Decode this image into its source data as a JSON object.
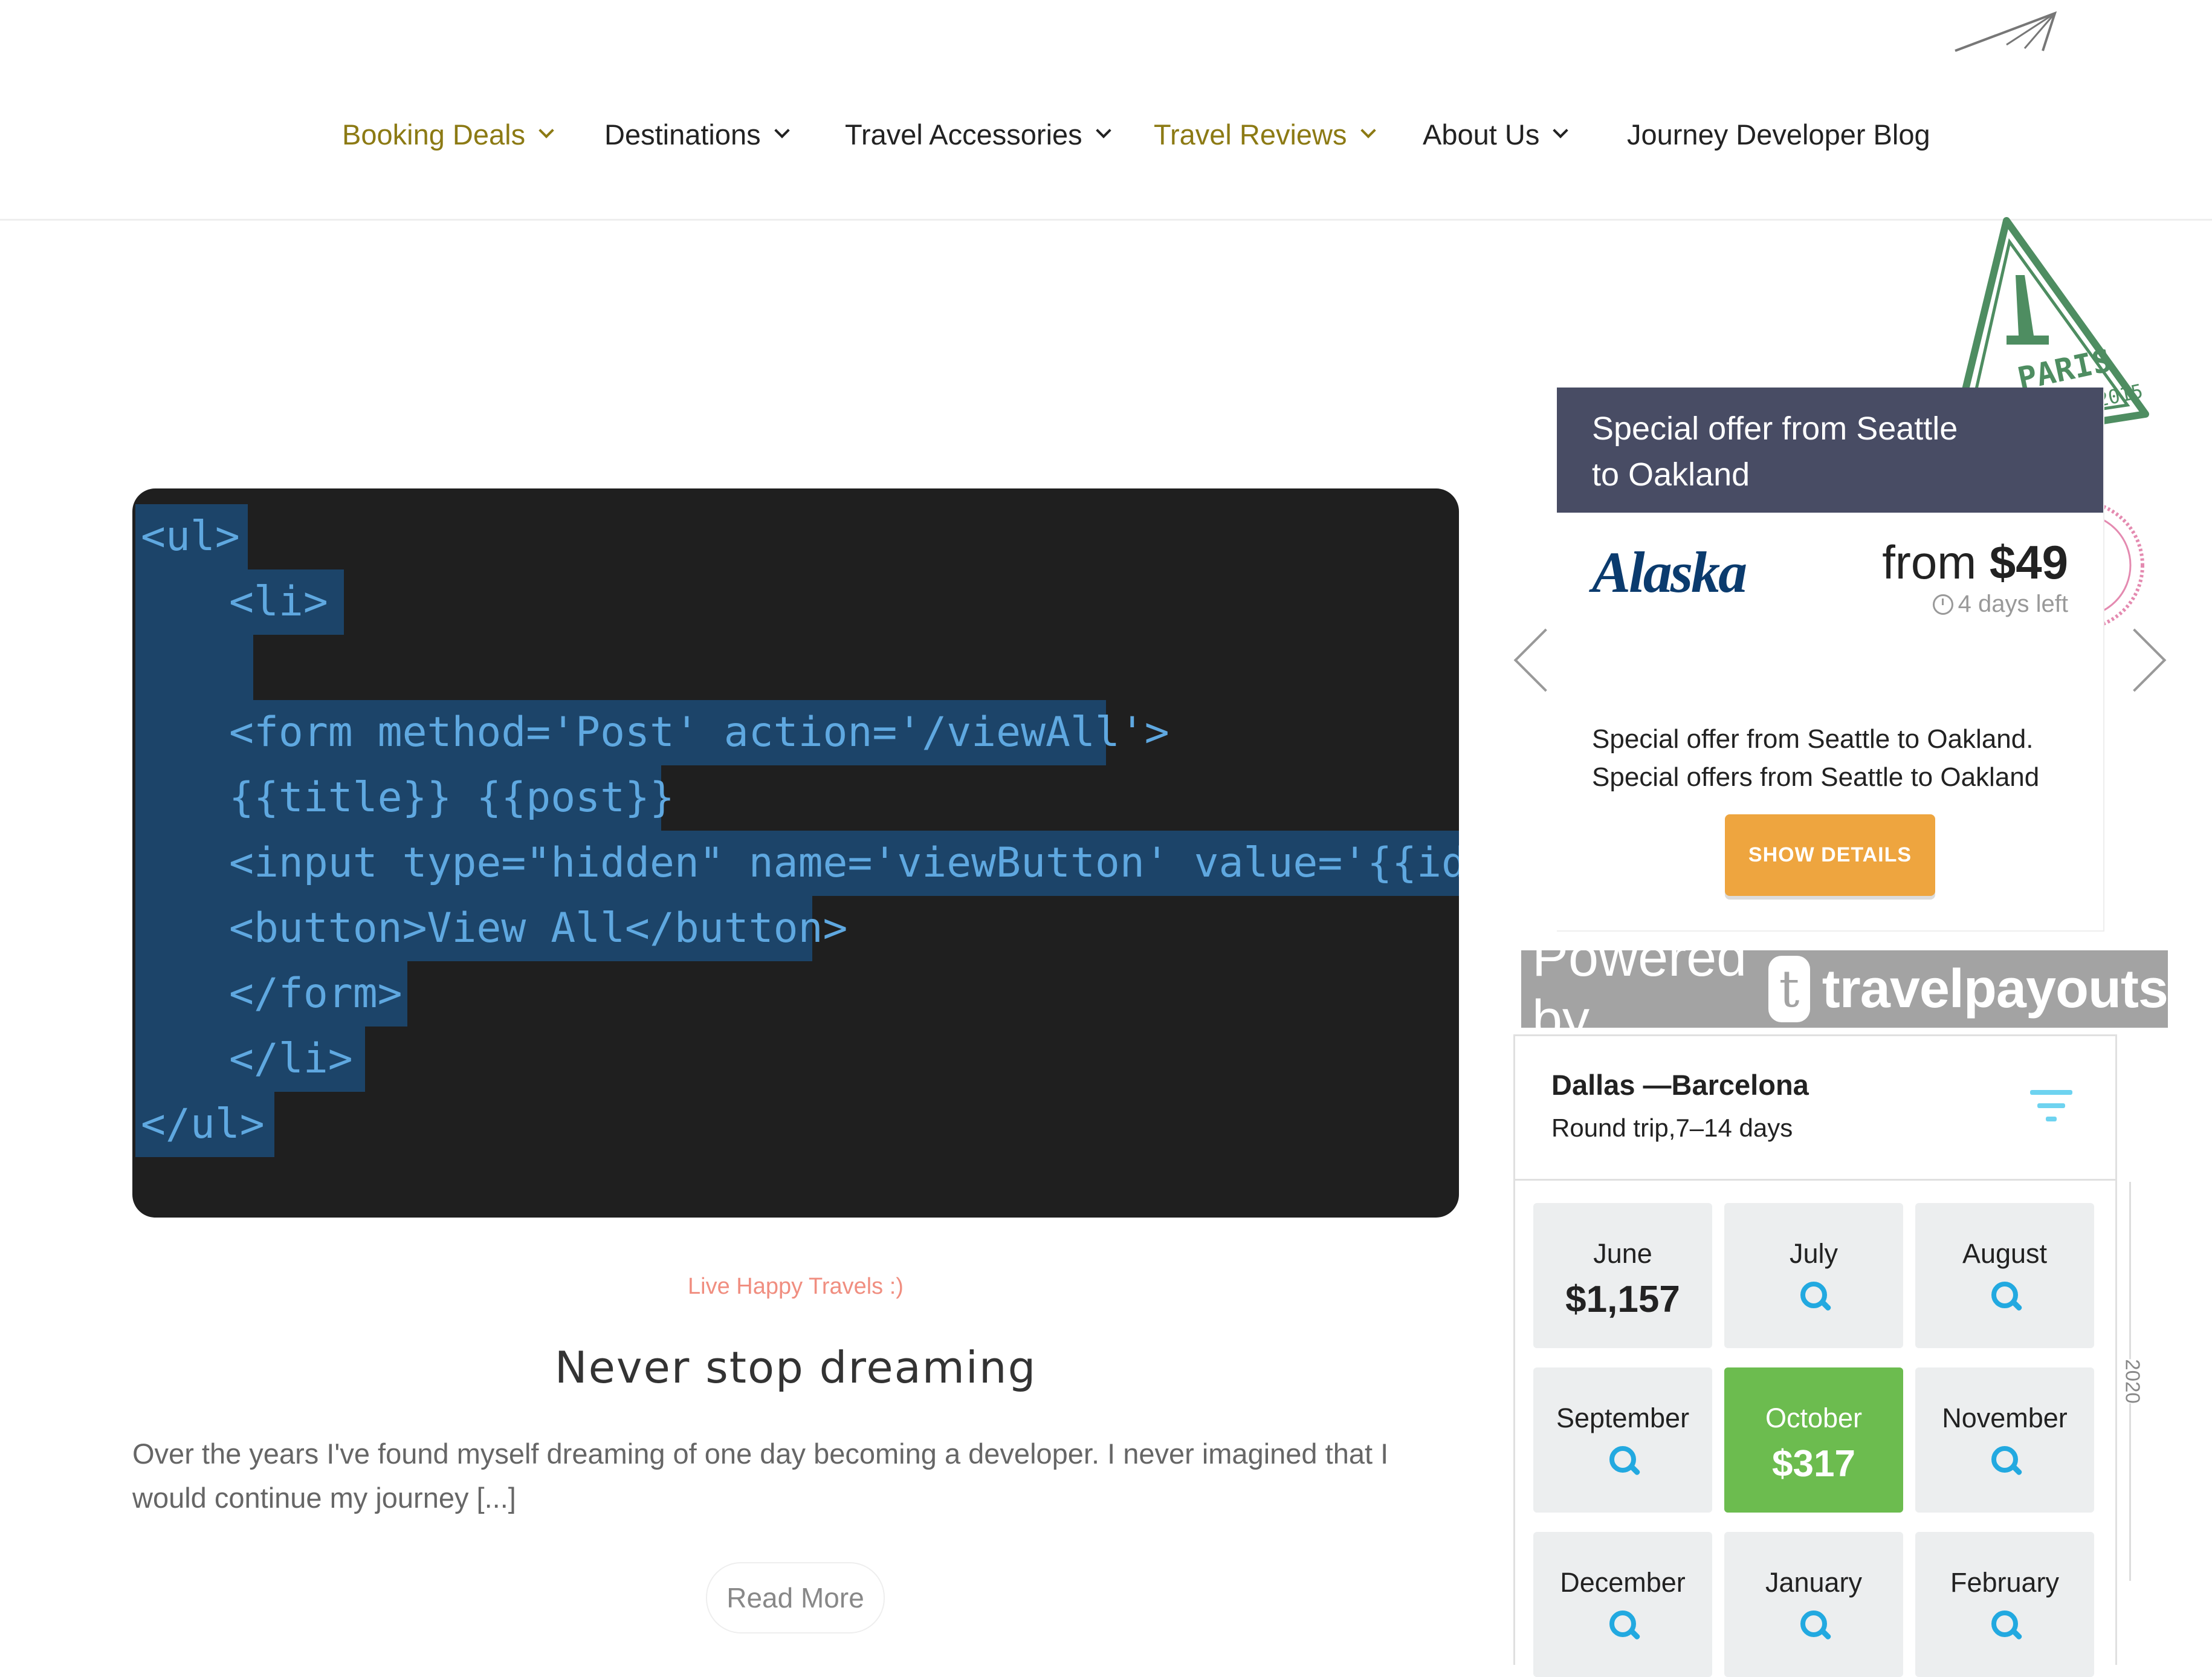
{
  "nav": {
    "items": [
      {
        "label": "Booking Deals",
        "has_dropdown": true,
        "color": "#8c7a14"
      },
      {
        "label": "Destinations",
        "has_dropdown": true
      },
      {
        "label": "Travel Accessories",
        "has_dropdown": true
      },
      {
        "label": "Travel Reviews",
        "has_dropdown": true,
        "color": "#8c7a14"
      },
      {
        "label": "About Us",
        "has_dropdown": true
      },
      {
        "label": "Journey Developer Blog",
        "has_dropdown": false
      }
    ],
    "logo_icon": "paper-plane-icon"
  },
  "stamp": {
    "city": "PARIS",
    "date": "20.05.2015"
  },
  "post": {
    "code_lines": [
      "<ul>",
      "<li>",
      "",
      "<form method='Post' action='/viewAll'>",
      "{{title}} {{post}}",
      "<input type=\"hidden\" name='viewButton' value='{{id}}'/>",
      "<button>View All</button>",
      "</form>",
      "</li>",
      "</ul>"
    ],
    "category": "Live Happy Travels :)",
    "title": "Never stop dreaming",
    "excerpt": "Over the years I've found myself dreaming of one day becoming a developer. I never imagined that I would continue my journey [...]",
    "read_more": "Read More"
  },
  "offer": {
    "title": "Special offer from Seattle to Oakland",
    "airline": "Alaska",
    "price_prefix": "from",
    "price": "$49",
    "days_left": "4 days left",
    "description": "Special offer from Seattle to Oakland. Special offers from Seattle to Oakland",
    "button": "SHOW DETAILS",
    "colors": {
      "header": "#484c64",
      "button": "#eea53f"
    }
  },
  "powered": {
    "prefix": "Powered by",
    "brand": "travelpayouts",
    "icon": "travelpayouts-logo-icon"
  },
  "calendar": {
    "route": "Dallas —Barcelona",
    "subtitle": "Round trip,7–14 days",
    "filter_icon": "filter-icon",
    "year": "2020",
    "months": [
      {
        "name": "June",
        "price": "$1,157",
        "active": false
      },
      {
        "name": "July",
        "price": null,
        "active": false
      },
      {
        "name": "August",
        "price": null,
        "active": false
      },
      {
        "name": "September",
        "price": null,
        "active": false
      },
      {
        "name": "October",
        "price": "$317",
        "active": true
      },
      {
        "name": "November",
        "price": null,
        "active": false
      },
      {
        "name": "December",
        "price": null,
        "active": false
      },
      {
        "name": "January",
        "price": null,
        "active": false
      },
      {
        "name": "February",
        "price": null,
        "active": false
      }
    ],
    "colors": {
      "active": "#6cbc4f",
      "search_icon": "#22a9e0"
    }
  }
}
